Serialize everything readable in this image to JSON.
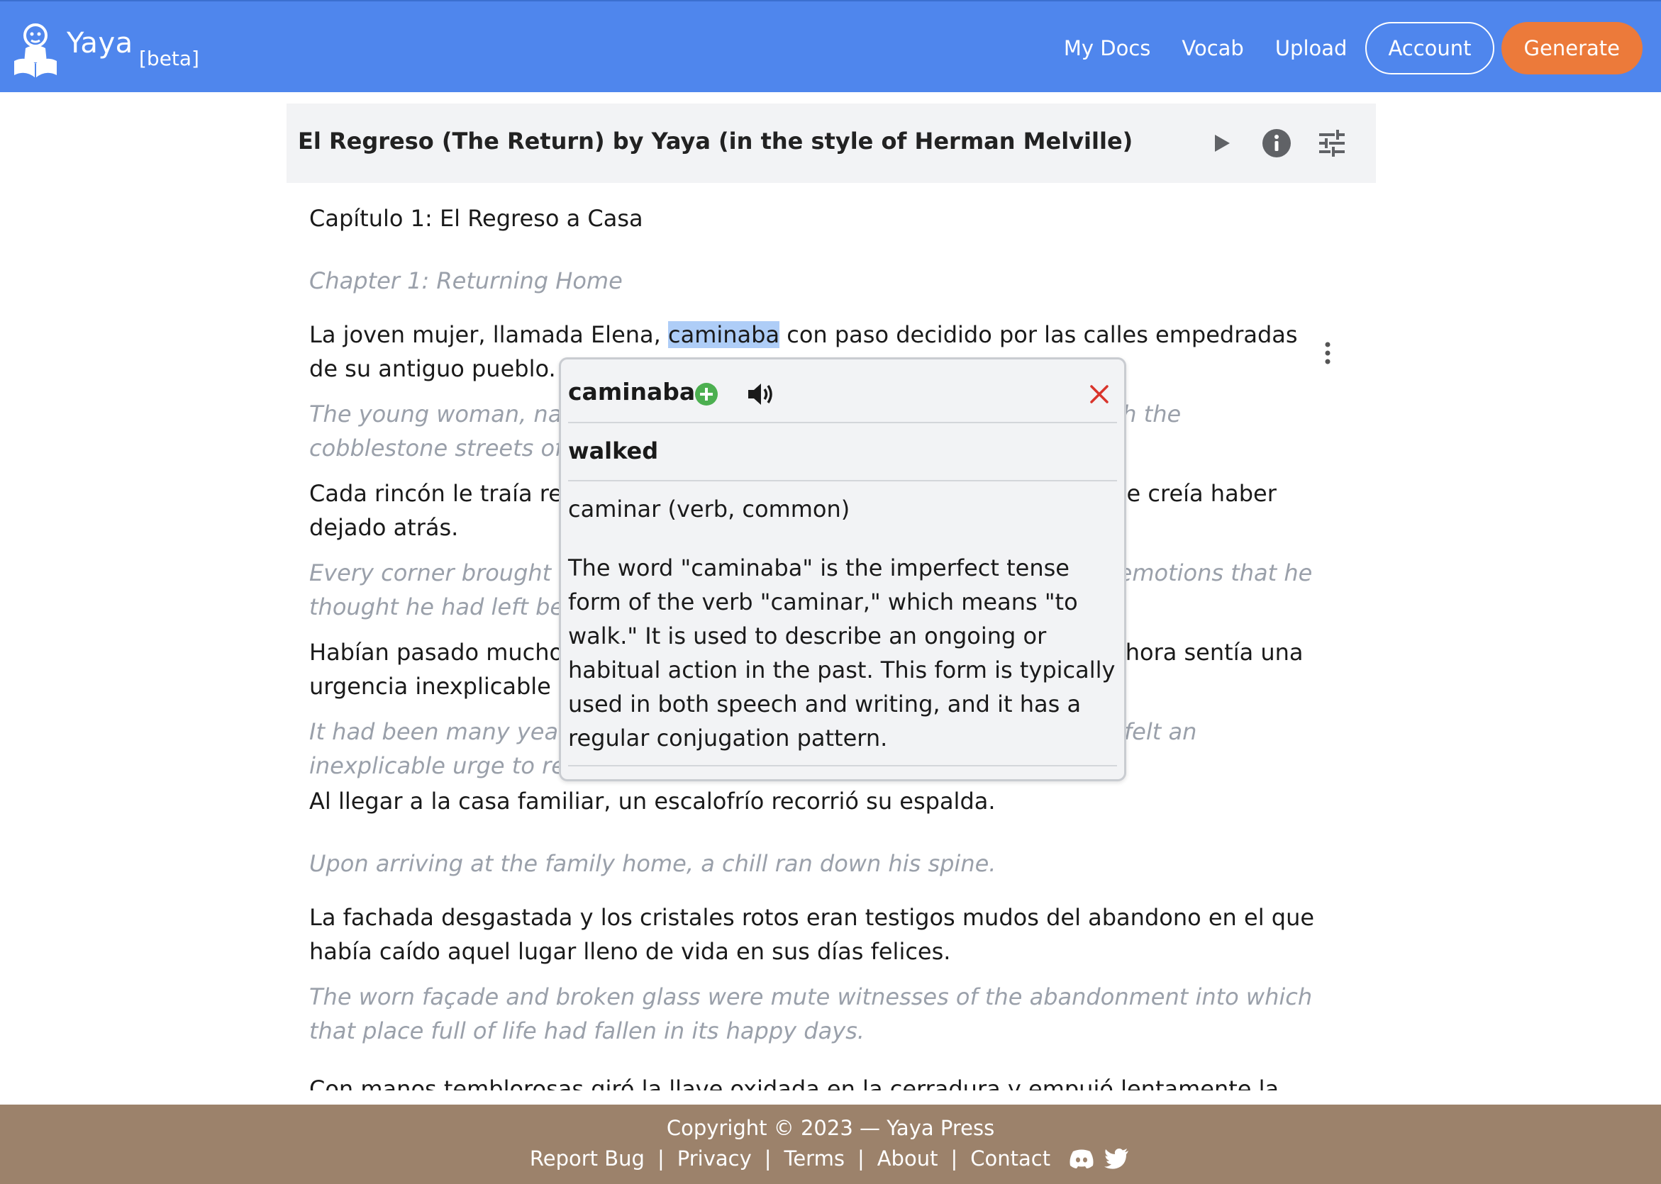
{
  "brand": {
    "name": "Yaya",
    "badge": "[beta]"
  },
  "nav": {
    "my_docs": "My Docs",
    "vocab": "Vocab",
    "upload": "Upload",
    "account": "Account",
    "generate": "Generate"
  },
  "document": {
    "title": "El Regreso (The Return) by Yaya (in the style of Herman Melville)",
    "icons": [
      "play-icon",
      "info-icon",
      "tune-icon"
    ]
  },
  "paragraphs": [
    {
      "es": "Capítulo 1: El Regreso a Casa",
      "en": "Chapter 1: Returning Home"
    },
    {
      "es_before": "La joven mujer, llamada Elena, ",
      "es_highlight": "caminaba",
      "es_after": " con paso decidido por las calles empedradas de su antiguo pueblo.",
      "en": "The young woman, named Elena, walked with determined steps through the cobblestone streets of her old village."
    },
    {
      "es": "Cada rincón le traía recuerdos de su infancia, y con ellos, emociones que creía haber dejado atrás.",
      "en": "Every corner brought back memories of her childhood, and with them, emotions that he thought he had left behind."
    },
    {
      "es": "Habían pasado muchos años desde la última vez que estuvo allí, pero ahora sentía una urgencia inexplicable de volver.",
      "en": "It had been many years since the last time she was there, but now she felt an inexplicable urge to return."
    },
    {
      "es": "Al llegar a la casa familiar, un escalofrío recorrió su espalda.",
      "en": "Upon arriving at the family home, a chill ran down his spine."
    },
    {
      "es": "La fachada desgastada y los cristales rotos eran testigos mudos del abandono en el que había caído aquel lugar lleno de vida en sus días felices.",
      "en": "The worn façade and broken glass were mute witnesses of the abandonment into which that place full of life had fallen in its happy days."
    },
    {
      "es": "Con manos temblorosas giró la llave oxidada en la cerradura y empujó lentamente la"
    }
  ],
  "popup": {
    "word": "caminaba",
    "translation": "walked",
    "lemma": "caminar (verb, common)",
    "explanation": "The word \"caminaba\" is the imperfect tense form of the verb \"caminar,\" which means \"to walk.\" It is used to describe an ongoing or habitual action in the past. This form is typically used in both speech and writing, and it has a regular conjugation pattern."
  },
  "footer": {
    "copyright": "Copyright © 2023 — Yaya Press",
    "links": [
      "Report Bug",
      "Privacy",
      "Terms",
      "About",
      "Contact"
    ],
    "separator": "|",
    "social": [
      "discord-icon",
      "twitter-icon"
    ]
  },
  "colors": {
    "topbar": "#4f86ed",
    "generate": "#ec7a3a",
    "footer": "#9c826b",
    "highlight": "#aecdf7",
    "translation_text": "#9aa0aa",
    "add_icon": "#4caf50",
    "close_icon": "#d9342b"
  }
}
